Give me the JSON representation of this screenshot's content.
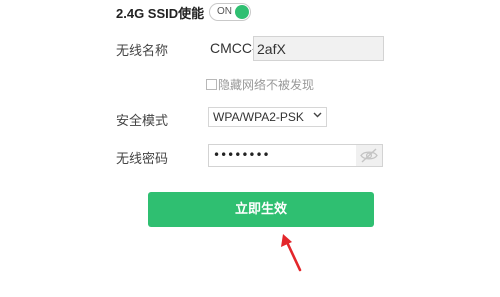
{
  "ssid_enable": {
    "label": "2.4G SSID使能",
    "toggle_text": "ON",
    "on": true
  },
  "wifi_name": {
    "label": "无线名称",
    "prefix": "CMCC-",
    "value": "2afX"
  },
  "hide_network": {
    "label": "隐藏网络不被发现",
    "checked": false
  },
  "security": {
    "label": "安全模式",
    "selected": "WPA/WPA2-PSK"
  },
  "password": {
    "label": "无线密码",
    "masked_value": "••••••••"
  },
  "submit": {
    "label": "立即生效"
  },
  "colors": {
    "accent": "#2fbf71",
    "annotation_arrow": "#e3262b"
  },
  "icons": [
    "eye-slash-icon",
    "chevron-down-icon",
    "annotation-arrow-icon"
  ]
}
